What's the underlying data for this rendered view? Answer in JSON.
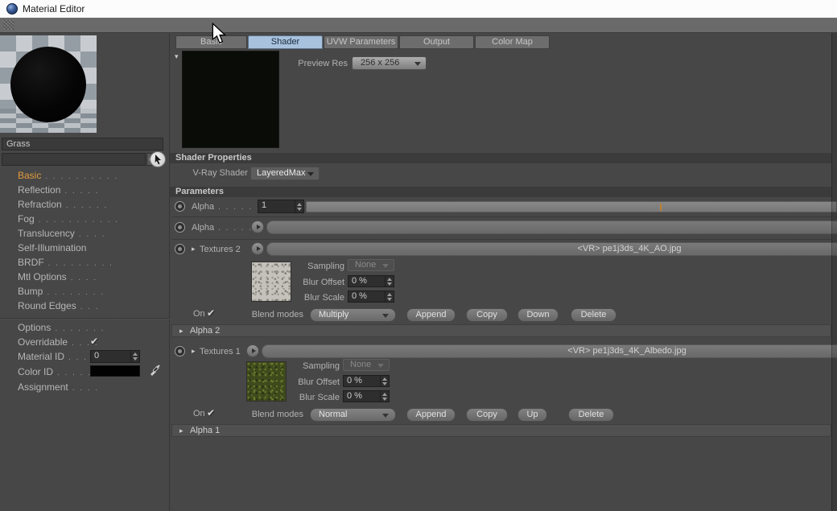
{
  "titlebar": {
    "title": "Material Editor"
  },
  "icons": {
    "check": "✔",
    "collapsed": "▸",
    "expanded": "▾"
  },
  "tabs": {
    "basic": "Basic",
    "shader": "Shader",
    "uvw": "UVW Parameters",
    "output": "Output",
    "colormap": "Color Map"
  },
  "preview": {
    "res_label": "Preview Res",
    "res_value": "256 x 256"
  },
  "sections": {
    "shader_properties": "Shader Properties",
    "parameters": "Parameters"
  },
  "shader": {
    "vray_label": "V-Ray Shader",
    "vray_value": "LayeredMax"
  },
  "params": {
    "alpha_slider": {
      "label": "Alpha",
      "dots": ". . . . . .",
      "value": "1"
    },
    "alpha_empty": {
      "label": "Alpha",
      "dots": ". . . . . ."
    },
    "sampling_label": "Sampling",
    "sampling_value": "None",
    "blur_offset_label": "Blur Offset",
    "blur_scale_label": "Blur Scale",
    "blur_value": "0 %",
    "on_label": "On",
    "blend_label": "Blend modes",
    "group_alpha2": "Alpha 2",
    "group_alpha1": "Alpha 1",
    "textures2": {
      "label": "Textures 2",
      "file": "<VR> pe1j3ds_4K_AO.jpg",
      "blend_value": "Multiply",
      "buttons": {
        "append": "Append",
        "copy": "Copy",
        "move": "Down",
        "delete": "Delete"
      }
    },
    "textures1": {
      "label": "Textures 1",
      "file": "<VR> pe1j3ds_4K_Albedo.jpg",
      "blend_value": "Normal",
      "buttons": {
        "append": "Append",
        "copy": "Copy",
        "move": "Up",
        "delete": "Delete"
      }
    }
  },
  "sidebar": {
    "name_value": "Grass",
    "channels": [
      {
        "label": "Basic",
        "dots": ". . . . . . . . . ."
      },
      {
        "label": "Reflection",
        "dots": ". . . . ."
      },
      {
        "label": "Refraction",
        "dots": ". . . . . ."
      },
      {
        "label": "Fog",
        "dots": ". . . . . . . . . . ."
      },
      {
        "label": "Translucency",
        "dots": ". . . ."
      },
      {
        "label": "Self-Illumination",
        "dots": ""
      },
      {
        "label": "BRDF",
        "dots": ". . . . . . . . ."
      },
      {
        "label": "Mtl Options",
        "dots": ". . . ."
      },
      {
        "label": "Bump",
        "dots": ". . . . . . . ."
      },
      {
        "label": "Round Edges",
        "dots": ". . ."
      }
    ],
    "options": {
      "label": "Options",
      "dots": ". . . . . . ."
    },
    "overridable": {
      "label": "Overridable",
      "dots": ". . . ."
    },
    "material_id": {
      "label": "Material ID",
      "dots": ". . . . .",
      "value": "0"
    },
    "color_id": {
      "label": "Color ID",
      "dots": ". . . . . . . ."
    },
    "assignment": {
      "label": "Assignment",
      "dots": ". . . ."
    }
  },
  "colors": {
    "background": "#474747",
    "panel_header": "#3b3b3b",
    "tab_active": "#a8c2de",
    "accent_orange": "#e09a3c",
    "slider_tick": "#bd8030"
  }
}
